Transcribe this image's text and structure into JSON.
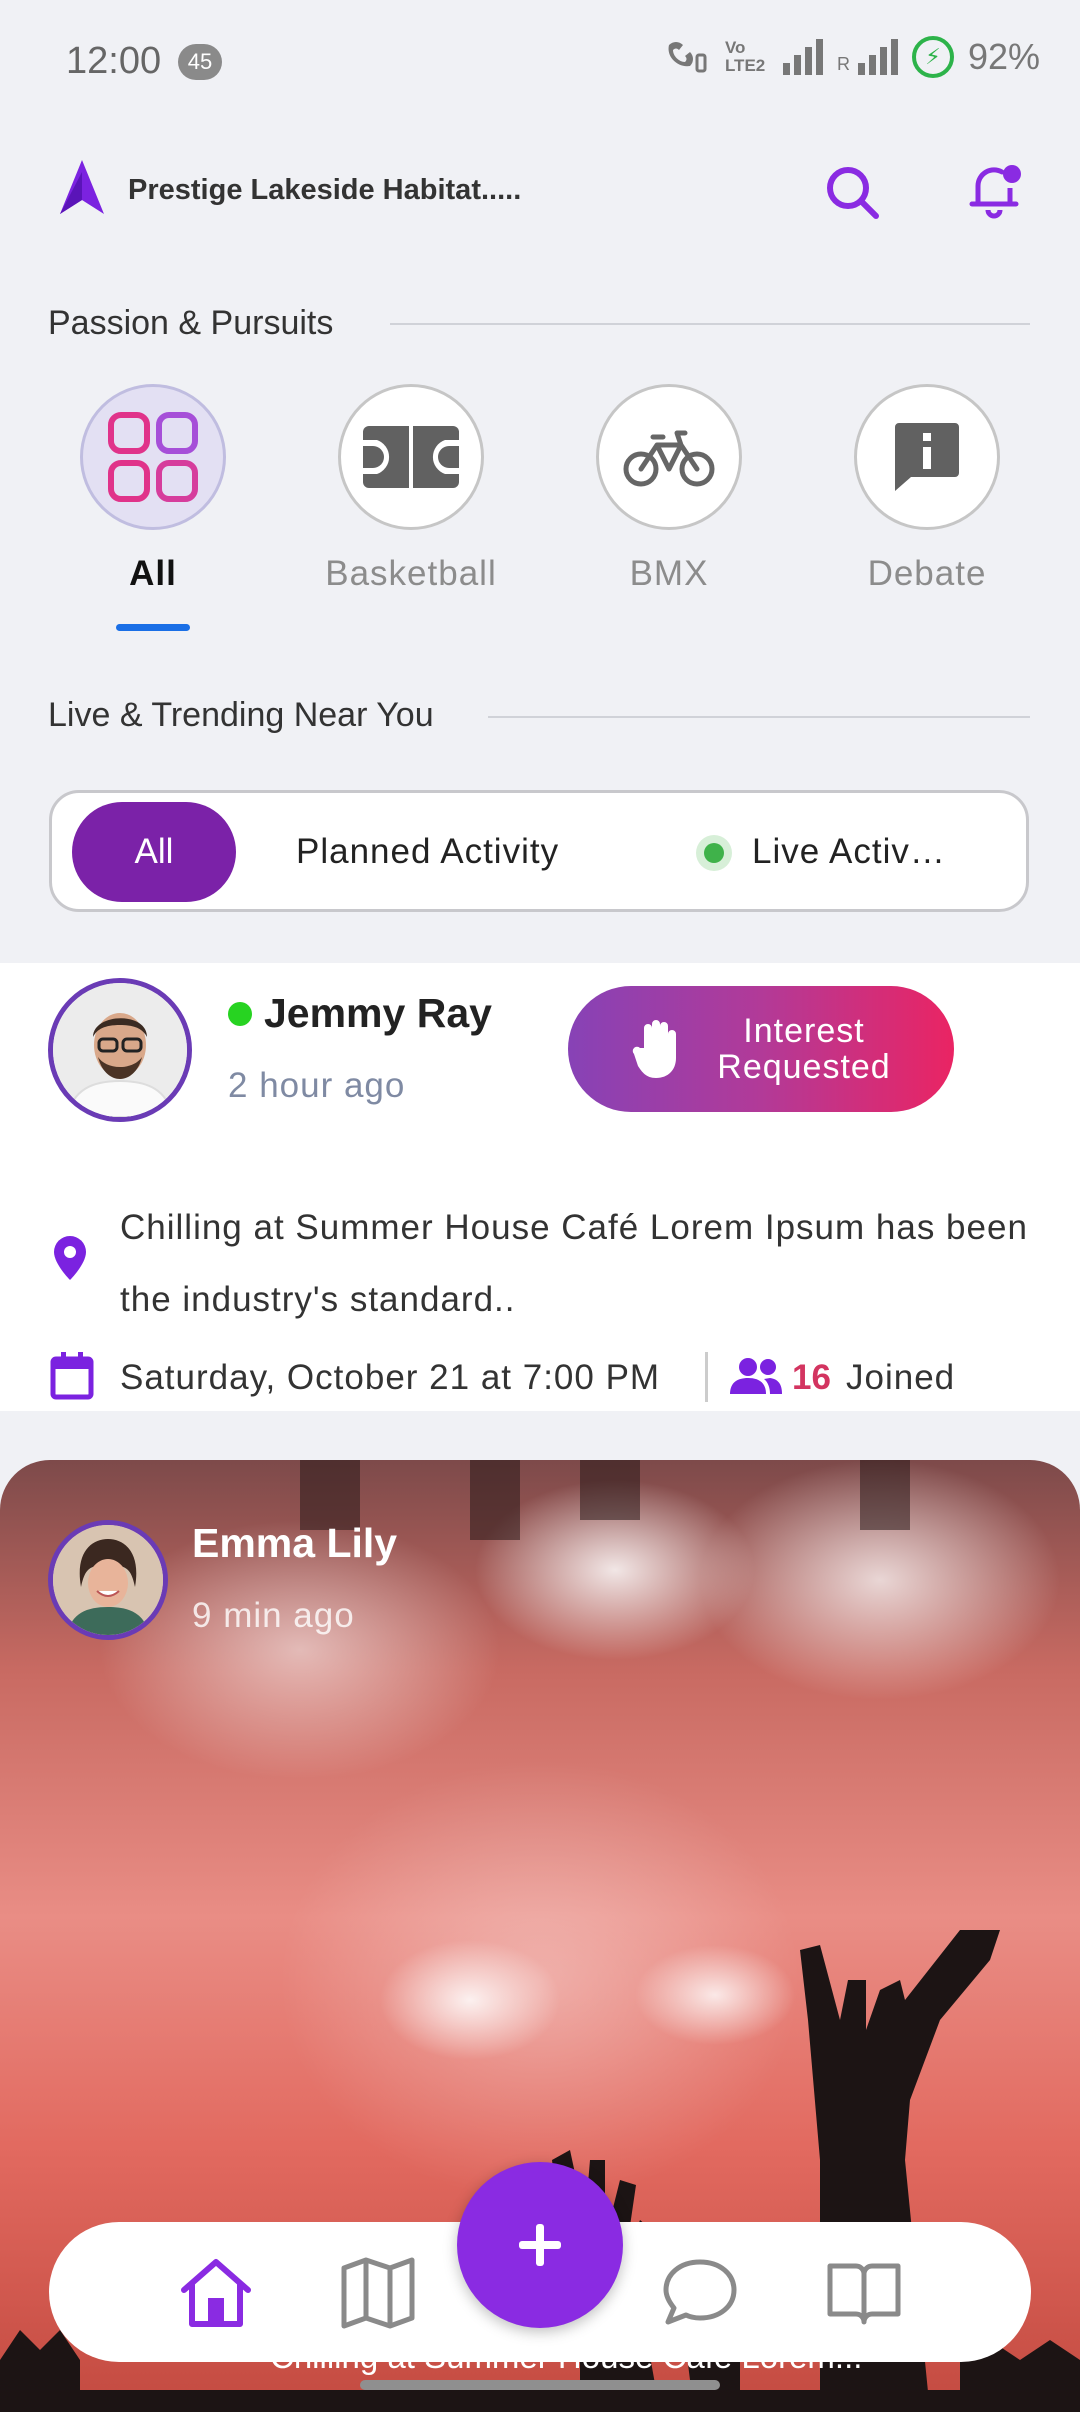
{
  "status_bar": {
    "time": "12:00",
    "notification_count": "45",
    "battery_percent": "92%",
    "network_label": "Vo LTE2",
    "accent": "#2db34a"
  },
  "header": {
    "location": "Prestige Lakeside Habitat.....",
    "brand_color": "#7b22e0"
  },
  "passion_section": {
    "title": "Passion & Pursuits",
    "categories": [
      {
        "label": "All",
        "icon": "grid-icon",
        "selected": true
      },
      {
        "label": "Basketball",
        "icon": "basketball-court-icon",
        "selected": false
      },
      {
        "label": "BMX",
        "icon": "bicycle-icon",
        "selected": false
      },
      {
        "label": "Debate",
        "icon": "info-chat-icon",
        "selected": false
      }
    ]
  },
  "trending_section": {
    "title": "Live & Trending Near You",
    "filters": {
      "all": "All",
      "planned": "Planned Activity",
      "live": "Live Activ…"
    },
    "selected_filter": "All"
  },
  "post1": {
    "user": "Jemmy Ray",
    "time": "2 hour ago",
    "interest_button": "Interest Requested",
    "description": "Chilling at Summer House Café Lorem Ipsum has been the industry's standard..",
    "date": "Saturday, October 21 at 7:00 PM",
    "joined_count": "16",
    "joined_label": "Joined"
  },
  "post2": {
    "user": "Emma Lily",
    "time": "9 min ago",
    "caption": "Chilling at Summer House Cafe Lorem..."
  },
  "bottom_nav": {
    "items": [
      "home-icon",
      "map-icon",
      "add-icon",
      "chat-icon",
      "book-icon"
    ],
    "active": "home-icon",
    "fab_color": "#8a2be2"
  }
}
